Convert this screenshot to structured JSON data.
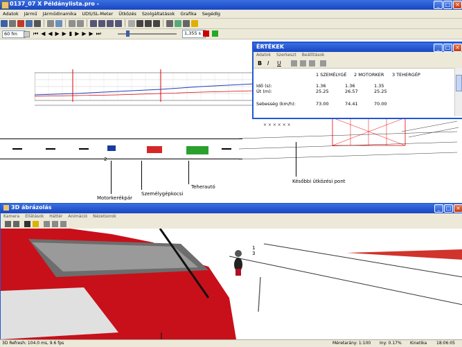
{
  "app": {
    "title": "0137_07 X Példánylista.pro -",
    "menu": [
      "Adatok",
      "Jármű",
      "Járműdinamika",
      "UDS/SL-Meter",
      "Ütközés",
      "Szolgáltatások",
      "Grafika",
      "Segédlg"
    ]
  },
  "toolbar2": {
    "fps_select": "60 fm",
    "time_field": "1,355 s"
  },
  "drawing": {
    "labels": {
      "motorbike": "Motorkerékpár",
      "car": "Személygépkocsi",
      "truck": "Teherautó",
      "later_collision": "Későbbi ütközési pont"
    },
    "markers": {
      "m1": "1",
      "m2": "2",
      "m3": "3"
    }
  },
  "values_window": {
    "title": "ÉRTÉKEK",
    "menu": [
      "Adatok",
      "Szerkeszt",
      "Beállítások"
    ],
    "columns": [
      "1 SZEMÉLYGÉ",
      "2 MOTORKER",
      "3 TEHERGÉP"
    ],
    "rows": [
      {
        "label": "Idő (s):",
        "values": [
          "1.36",
          "1.36",
          "1.35"
        ]
      },
      {
        "label": "Út (m):",
        "values": [
          "25.25",
          "26.57",
          "25.25"
        ]
      },
      {
        "label": "Sebesség (km/h):",
        "values": [
          "73.00",
          "74.41",
          "70.00"
        ]
      }
    ]
  },
  "win3d": {
    "title": "3D ábrázolás",
    "menu": [
      "Kamera",
      "Ellátások",
      "Háttér",
      "Animáció",
      "Nézetsorok"
    ]
  },
  "statusbar": {
    "refresh": "3D Refresh: 104.0 ms, 9.6 fps",
    "scale": "Méretarány: 1:100",
    "iny": "Iny: 0.17%",
    "mode": "Kinetika",
    "time": "18:06:05"
  },
  "colors": {
    "titlebar": "#1f57d6",
    "truck": "#2ca02c",
    "car": "#d62728",
    "motorbike": "#1a3a9e"
  }
}
